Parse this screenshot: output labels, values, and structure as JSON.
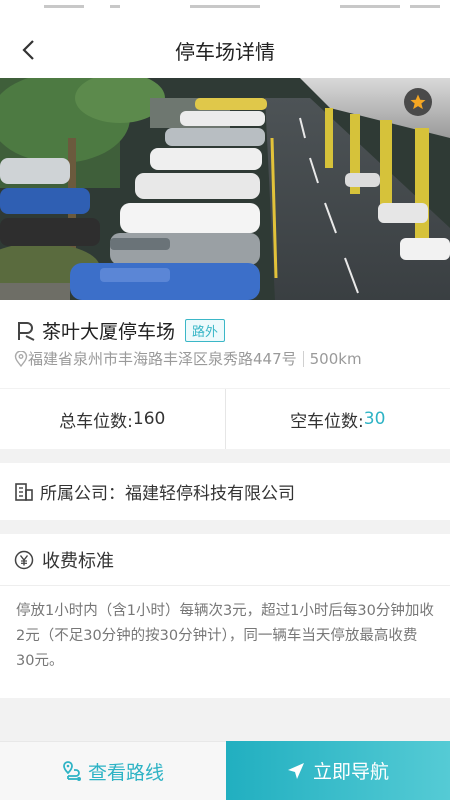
{
  "nav": {
    "title": "停车场详情"
  },
  "lot": {
    "name": "茶叶大厦停车场",
    "type_tag": "路外",
    "address": "福建省泉州市丰海路丰泽区泉秀路447号",
    "distance": "500km"
  },
  "counts": {
    "total_label": "总车位数: ",
    "total_value": "160",
    "free_label": "空车位数: ",
    "free_value": "30"
  },
  "company": {
    "label": "所属公司：",
    "value": "福建轻停科技有限公司"
  },
  "fee": {
    "title": "收费标准",
    "text": "停放1小时内（含1小时）每辆次3元，超过1小时后每30分钟加收2元（不足30分钟的按30分钟计），同一辆车当天停放最高收费30元。"
  },
  "actions": {
    "route_label": "查看路线",
    "navigate_label": "立即导航"
  },
  "icons": {
    "back": "chevron-left-icon",
    "favorite": "star-icon",
    "parking": "parking-icon",
    "location": "location-pin-icon",
    "company": "building-icon",
    "fee": "yen-icon",
    "route": "route-icon",
    "navigate": "navigation-arrow-icon"
  },
  "colors": {
    "accent": "#2eb3c5",
    "favorite": "#f5a623"
  }
}
